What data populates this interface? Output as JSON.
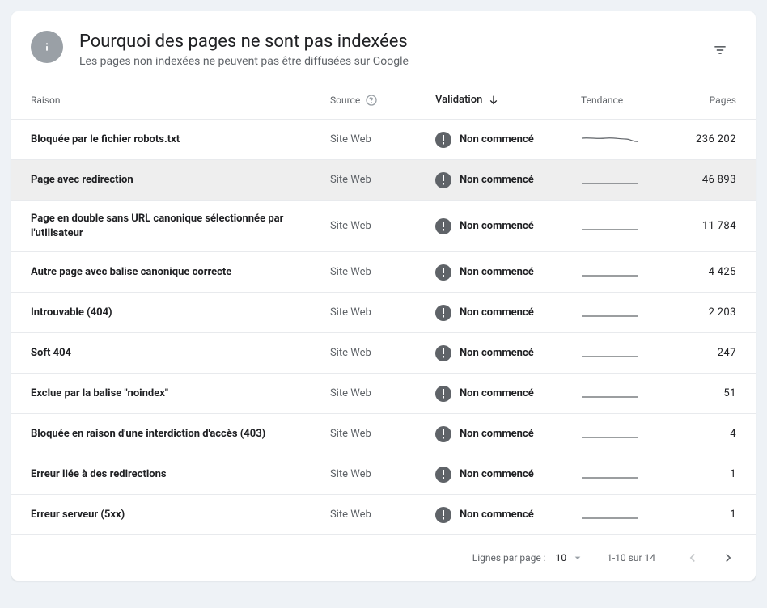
{
  "header": {
    "title": "Pourquoi des pages ne sont pas indexées",
    "subtitle": "Les pages non indexées ne peuvent pas être diffusées sur Google"
  },
  "columns": {
    "reason": "Raison",
    "source": "Source",
    "validation": "Validation",
    "trend": "Tendance",
    "pages": "Pages"
  },
  "data": {
    "source_label": "Site Web",
    "validation_label": "Non commencé"
  },
  "rows": [
    {
      "reason": "Bloquée par le fichier robots.txt",
      "pages": "236 202",
      "trend": "wavy"
    },
    {
      "reason": "Page avec redirection",
      "pages": "46 893",
      "trend": "flat",
      "selected": true
    },
    {
      "reason": "Page en double sans URL canonique sélectionnée par l'utilisateur",
      "pages": "11 784",
      "trend": "flat",
      "tall": true
    },
    {
      "reason": "Autre page avec balise canonique correcte",
      "pages": "4 425",
      "trend": "flat"
    },
    {
      "reason": "Introuvable (404)",
      "pages": "2 203",
      "trend": "flat"
    },
    {
      "reason": "Soft 404",
      "pages": "247",
      "trend": "flat"
    },
    {
      "reason": "Exclue par la balise \"noindex\"",
      "pages": "51",
      "trend": "flat"
    },
    {
      "reason": "Bloquée en raison d'une interdiction d'accès (403)",
      "pages": "4",
      "trend": "flat"
    },
    {
      "reason": "Erreur liée à des redirections",
      "pages": "1",
      "trend": "flat"
    },
    {
      "reason": "Erreur serveur (5xx)",
      "pages": "1",
      "trend": "flat"
    }
  ],
  "footer": {
    "rows_per_page_label": "Lignes par page :",
    "rows_per_page_value": "10",
    "range": "1-10 sur 14"
  }
}
